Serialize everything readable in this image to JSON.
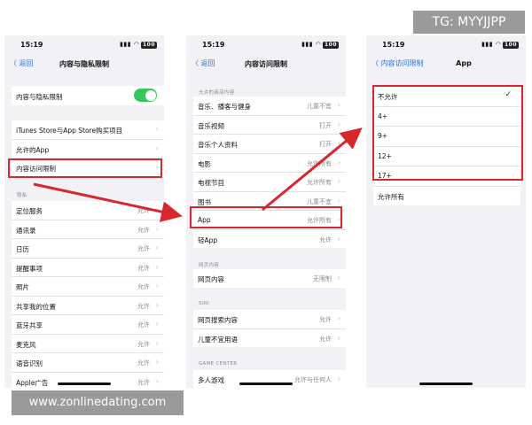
{
  "colors": {
    "accent": "#2a6fd6",
    "highlight": "#d8272f",
    "toggle_on": "#34c759"
  },
  "watermark_top": "TG: MYYJJPP",
  "watermark_bottom": "www.zonlinedating.com",
  "screen1": {
    "time": "15:19",
    "status_icons": "▮▮▮ ◠",
    "battery": "100",
    "back": "〈 返回",
    "title": "内容与隐私限制",
    "toggle_label": "内容与隐私限制",
    "group1": [
      "iTunes Store与App Store购买项目",
      "允许的App",
      "内容访问限制"
    ],
    "privacy_header": "隐私",
    "privacy": [
      {
        "label": "定位服务",
        "value": "允许"
      },
      {
        "label": "通讯录",
        "value": "允许"
      },
      {
        "label": "日历",
        "value": "允许"
      },
      {
        "label": "提醒事项",
        "value": "允许"
      },
      {
        "label": "照片",
        "value": "允许"
      },
      {
        "label": "共享我的位置",
        "value": "允许"
      },
      {
        "label": "蓝牙共享",
        "value": "允许"
      },
      {
        "label": "麦克风",
        "value": "允许"
      },
      {
        "label": "语音识别",
        "value": "允许"
      },
      {
        "label": "Apple广告",
        "value": "允许"
      }
    ]
  },
  "screen2": {
    "time": "15:19",
    "status_icons": "▮▮▮ ◠",
    "battery": "100",
    "back": "〈 返回",
    "title": "内容访问限制",
    "store_header": "允许的商店内容",
    "store": [
      {
        "label": "音乐、播客与健身",
        "value": "儿童不宜"
      },
      {
        "label": "音乐视频",
        "value": "打开"
      },
      {
        "label": "音乐个人资料",
        "value": "打开"
      },
      {
        "label": "电影",
        "value": "允许所有"
      },
      {
        "label": "电视节目",
        "value": "允许所有"
      },
      {
        "label": "图书",
        "value": "儿童不宜"
      },
      {
        "label": "App",
        "value": "允许所有"
      },
      {
        "label": "轻App",
        "value": "允许"
      }
    ],
    "web_header": "网页内容",
    "web": [
      {
        "label": "网页内容",
        "value": "无限制"
      }
    ],
    "siri_header": "SIRI",
    "siri": [
      {
        "label": "网页搜索内容",
        "value": "允许"
      },
      {
        "label": "儿童不宜用语",
        "value": "允许"
      }
    ],
    "gc_header": "GAME CENTER",
    "gc": [
      {
        "label": "多人游戏",
        "value": "允许与任何人"
      }
    ]
  },
  "screen3": {
    "time": "15:19",
    "status_icons": "▮▮▮ ◠",
    "battery": "100",
    "back": "〈 内容访问限制",
    "title": "App",
    "options": [
      "不允许",
      "4+",
      "9+",
      "12+",
      "17+"
    ],
    "selected_mark": "✓",
    "allow_all": "允许所有"
  }
}
